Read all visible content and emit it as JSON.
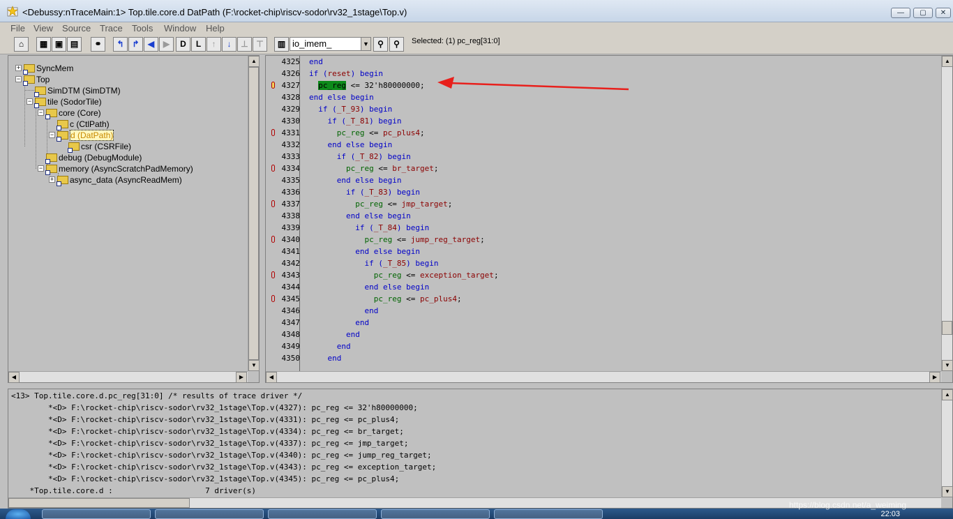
{
  "window": {
    "title": "<Debussy:nTraceMain:1> Top.tile.core.d DatPath (F:\\rocket-chip\\riscv-sodor\\rv32_1stage\\Top.v)",
    "minimize": "—",
    "maximize": "▢",
    "close": "✕"
  },
  "menu": [
    "File",
    "View",
    "Source",
    "Trace",
    "Tools",
    "Window",
    "Help"
  ],
  "toolbar": {
    "signal_combo": "io_imem_",
    "selected_text": "Selected: (1) pc_reg[31:0]"
  },
  "tree": [
    {
      "label": "SyncMem",
      "expander": "+"
    },
    {
      "label": "Top",
      "expander": "−"
    },
    {
      "label": "SimDTM (SimDTM)",
      "expander": ""
    },
    {
      "label": "tile (SodorTile)",
      "expander": "−"
    },
    {
      "label": "core (Core)",
      "expander": "−"
    },
    {
      "label": "c (CtlPath)",
      "expander": ""
    },
    {
      "label": "d (DatPath)",
      "expander": "−",
      "selected": true
    },
    {
      "label": "csr (CSRFile)",
      "expander": ""
    },
    {
      "label": "debug (DebugModule)",
      "expander": ""
    },
    {
      "label": "memory (AsyncScratchPadMemory)",
      "expander": "−"
    },
    {
      "label": "async_data (AsyncReadMem)",
      "expander": "+"
    }
  ],
  "source": [
    {
      "num": "4325",
      "mark": "",
      "indent": "",
      "parts": [
        [
          "kw",
          "end"
        ]
      ]
    },
    {
      "num": "4326",
      "mark": "",
      "indent": "",
      "parts": [
        [
          "kw",
          "if ("
        ],
        [
          "rhs",
          "reset"
        ],
        [
          "kw",
          ") begin"
        ]
      ]
    },
    {
      "num": "4327",
      "mark": "filled",
      "indent": "  ",
      "parts": [
        [
          "hl",
          "pc_reg"
        ],
        [
          "plain",
          " <= 32'h80000000;"
        ]
      ]
    },
    {
      "num": "4328",
      "mark": "",
      "indent": "",
      "parts": [
        [
          "kw",
          "end else begin"
        ]
      ]
    },
    {
      "num": "4329",
      "mark": "",
      "indent": "  ",
      "parts": [
        [
          "kw",
          "if ("
        ],
        [
          "rhs",
          "_T_93"
        ],
        [
          "kw",
          ") begin"
        ]
      ]
    },
    {
      "num": "4330",
      "mark": "",
      "indent": "    ",
      "parts": [
        [
          "kw",
          "if ("
        ],
        [
          "rhs",
          "_T_81"
        ],
        [
          "kw",
          ") begin"
        ]
      ]
    },
    {
      "num": "4331",
      "mark": "hollow",
      "indent": "      ",
      "parts": [
        [
          "sig",
          "pc_reg"
        ],
        [
          "plain",
          " <= "
        ],
        [
          "rhs",
          "pc_plus4"
        ],
        [
          "plain",
          ";"
        ]
      ]
    },
    {
      "num": "4332",
      "mark": "",
      "indent": "    ",
      "parts": [
        [
          "kw",
          "end else begin"
        ]
      ]
    },
    {
      "num": "4333",
      "mark": "",
      "indent": "      ",
      "parts": [
        [
          "kw",
          "if ("
        ],
        [
          "rhs",
          "_T_82"
        ],
        [
          "kw",
          ") begin"
        ]
      ]
    },
    {
      "num": "4334",
      "mark": "hollow",
      "indent": "        ",
      "parts": [
        [
          "sig",
          "pc_reg"
        ],
        [
          "plain",
          " <= "
        ],
        [
          "rhs",
          "br_target"
        ],
        [
          "plain",
          ";"
        ]
      ]
    },
    {
      "num": "4335",
      "mark": "",
      "indent": "      ",
      "parts": [
        [
          "kw",
          "end else begin"
        ]
      ]
    },
    {
      "num": "4336",
      "mark": "",
      "indent": "        ",
      "parts": [
        [
          "kw",
          "if ("
        ],
        [
          "rhs",
          "_T_83"
        ],
        [
          "kw",
          ") begin"
        ]
      ]
    },
    {
      "num": "4337",
      "mark": "hollow",
      "indent": "          ",
      "parts": [
        [
          "sig",
          "pc_reg"
        ],
        [
          "plain",
          " <= "
        ],
        [
          "rhs",
          "jmp_target"
        ],
        [
          "plain",
          ";"
        ]
      ]
    },
    {
      "num": "4338",
      "mark": "",
      "indent": "        ",
      "parts": [
        [
          "kw",
          "end else begin"
        ]
      ]
    },
    {
      "num": "4339",
      "mark": "",
      "indent": "          ",
      "parts": [
        [
          "kw",
          "if ("
        ],
        [
          "rhs",
          "_T_84"
        ],
        [
          "kw",
          ") begin"
        ]
      ]
    },
    {
      "num": "4340",
      "mark": "hollow",
      "indent": "            ",
      "parts": [
        [
          "sig",
          "pc_reg"
        ],
        [
          "plain",
          " <= "
        ],
        [
          "rhs",
          "jump_reg_target"
        ],
        [
          "plain",
          ";"
        ]
      ]
    },
    {
      "num": "4341",
      "mark": "",
      "indent": "          ",
      "parts": [
        [
          "kw",
          "end else begin"
        ]
      ]
    },
    {
      "num": "4342",
      "mark": "",
      "indent": "            ",
      "parts": [
        [
          "kw",
          "if ("
        ],
        [
          "rhs",
          "_T_85"
        ],
        [
          "kw",
          ") begin"
        ]
      ]
    },
    {
      "num": "4343",
      "mark": "hollow",
      "indent": "              ",
      "parts": [
        [
          "sig",
          "pc_reg"
        ],
        [
          "plain",
          " <= "
        ],
        [
          "rhs",
          "exception_target"
        ],
        [
          "plain",
          ";"
        ]
      ]
    },
    {
      "num": "4344",
      "mark": "",
      "indent": "            ",
      "parts": [
        [
          "kw",
          "end else begin"
        ]
      ]
    },
    {
      "num": "4345",
      "mark": "hollow",
      "indent": "              ",
      "parts": [
        [
          "sig",
          "pc_reg"
        ],
        [
          "plain",
          " <= "
        ],
        [
          "rhs",
          "pc_plus4"
        ],
        [
          "plain",
          ";"
        ]
      ]
    },
    {
      "num": "4346",
      "mark": "",
      "indent": "            ",
      "parts": [
        [
          "kw",
          "end"
        ]
      ]
    },
    {
      "num": "4347",
      "mark": "",
      "indent": "          ",
      "parts": [
        [
          "kw",
          "end"
        ]
      ]
    },
    {
      "num": "4348",
      "mark": "",
      "indent": "        ",
      "parts": [
        [
          "kw",
          "end"
        ]
      ]
    },
    {
      "num": "4349",
      "mark": "",
      "indent": "      ",
      "parts": [
        [
          "kw",
          "end"
        ]
      ]
    },
    {
      "num": "4350",
      "mark": "",
      "indent": "    ",
      "parts": [
        [
          "kw",
          "end"
        ]
      ]
    }
  ],
  "messages": [
    "<13> Top.tile.core.d.pc_reg[31:0] /* results of trace driver */",
    "        *<D> F:\\rocket-chip\\riscv-sodor\\rv32_1stage\\Top.v(4327): pc_reg <= 32'h80000000;",
    "        *<D> F:\\rocket-chip\\riscv-sodor\\rv32_1stage\\Top.v(4331): pc_reg <= pc_plus4;",
    "        *<D> F:\\rocket-chip\\riscv-sodor\\rv32_1stage\\Top.v(4334): pc_reg <= br_target;",
    "        *<D> F:\\rocket-chip\\riscv-sodor\\rv32_1stage\\Top.v(4337): pc_reg <= jmp_target;",
    "        *<D> F:\\rocket-chip\\riscv-sodor\\rv32_1stage\\Top.v(4340): pc_reg <= jump_reg_target;",
    "        *<D> F:\\rocket-chip\\riscv-sodor\\rv32_1stage\\Top.v(4343): pc_reg <= exception_target;",
    "        *<D> F:\\rocket-chip\\riscv-sodor\\rv32_1stage\\Top.v(4345): pc_reg <= pc_plus4;",
    "    *Top.tile.core.d :                    7 driver(s)"
  ],
  "taskbar": {
    "clock": "22:03",
    "watermark": "https://blog.csdn.net/a_weiming"
  },
  "colors": {
    "highlight": "#0c8a1a",
    "arrow": "#e8201c",
    "keyword": "#0000c8",
    "signal": "#006400",
    "expression": "#8b0000"
  }
}
